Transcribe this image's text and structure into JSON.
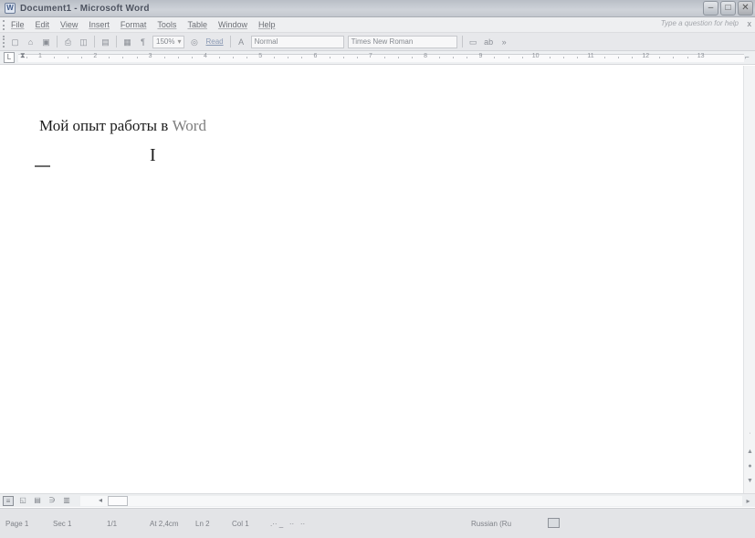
{
  "window": {
    "title": "Document1 - Microsoft Word",
    "min_icon": "minimize-icon",
    "max_icon": "maximize-icon",
    "close_icon": "close-icon"
  },
  "menu": {
    "items": [
      "File",
      "Edit",
      "View",
      "Insert",
      "Format",
      "Tools",
      "Table",
      "Window",
      "Help"
    ],
    "ask_placeholder": "Type a question for help",
    "close_label": "x"
  },
  "toolbar": {
    "zoom": "150%",
    "read_label": "Read",
    "style": "Normal",
    "font": "Times New Roman",
    "pilcrow": "¶"
  },
  "ruler": {
    "numbers": [
      "1",
      "2",
      "3",
      "4",
      "5",
      "6",
      "7",
      "8",
      "9",
      "10",
      "11",
      "12",
      "13"
    ]
  },
  "document": {
    "heading_text": "Мой опыт работы в ",
    "heading_word": "Word",
    "cursor_glyph": "I"
  },
  "status": {
    "page": "Page 1",
    "sec": "Sec 1",
    "pages": "1/1",
    "at": "At 2,4cm",
    "ln": "Ln 2",
    "col": "Col 1",
    "language": "Russian (Ru"
  }
}
